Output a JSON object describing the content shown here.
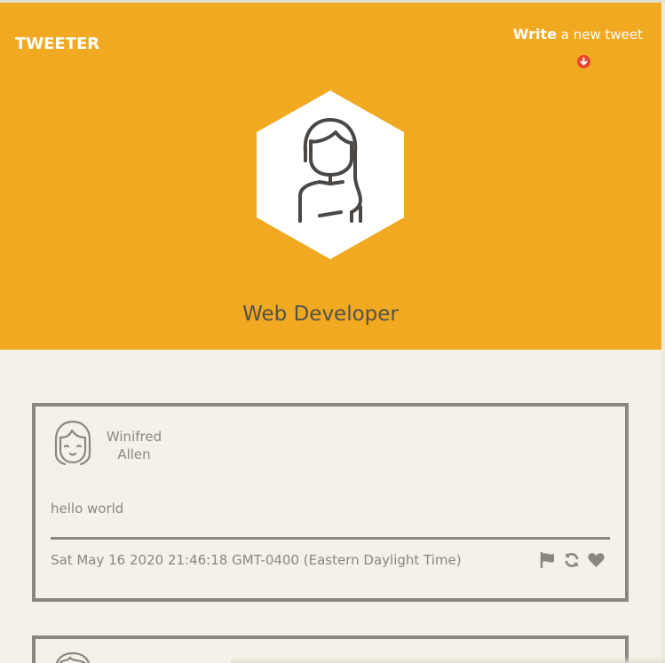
{
  "header": {
    "logo": "TWEETER",
    "compose_bold": "Write",
    "compose_rest": " a new tweet",
    "compose_icon": "arrow-down-circle-icon",
    "profile_name": "Web Developer",
    "background_color": "#f0a921"
  },
  "tweets": [
    {
      "author_first": "Winifred",
      "author_last": "Allen",
      "body": "hello world",
      "timestamp": "Sat May 16 2020 21:46:18 GMT-0400 (Eastern Daylight Time)",
      "actions": [
        "flag-icon",
        "retweet-icon",
        "heart-icon"
      ]
    }
  ]
}
